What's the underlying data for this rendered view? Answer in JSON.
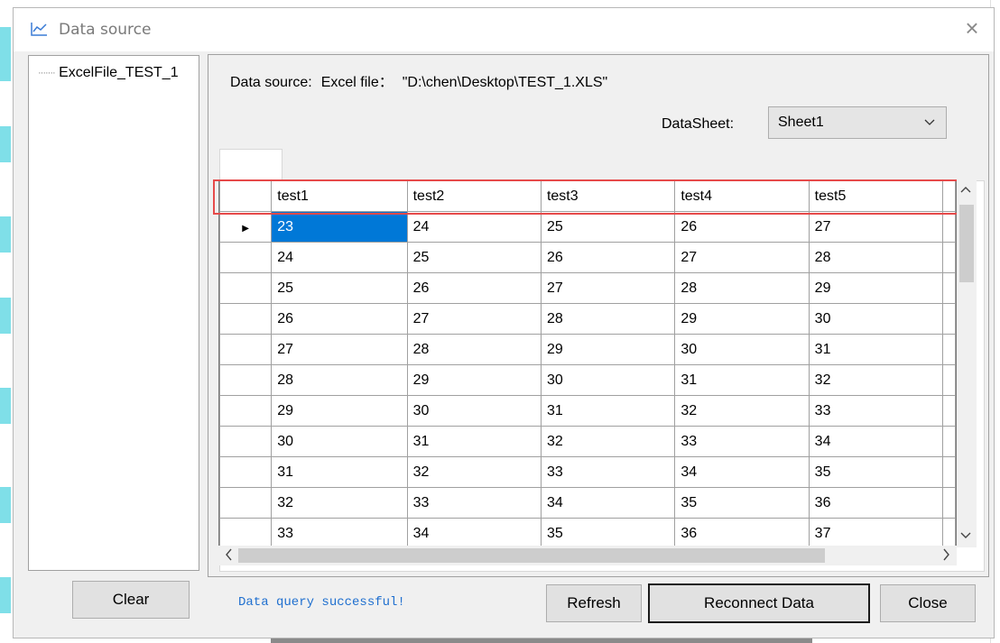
{
  "window": {
    "title": "Data source",
    "title_icon": "line-chart-icon",
    "close_icon": "close-icon",
    "close_glyph": "×"
  },
  "tree": {
    "items": [
      {
        "label": "ExcelFile_TEST_1"
      }
    ]
  },
  "buttons": {
    "clear": "Clear",
    "refresh": "Refresh",
    "reconnect": "Reconnect Data",
    "close": "Close"
  },
  "source": {
    "label": "Data source:",
    "type": "Excel file：",
    "path": "\"D:\\chen\\Desktop\\TEST_1.XLS\""
  },
  "datasheet": {
    "label": "DataSheet:",
    "selected": "Sheet1"
  },
  "grid": {
    "columns": [
      "test1",
      "test2",
      "test3",
      "test4",
      "test5"
    ],
    "rows": [
      [
        "23",
        "24",
        "25",
        "26",
        "27"
      ],
      [
        "24",
        "25",
        "26",
        "27",
        "28"
      ],
      [
        "25",
        "26",
        "27",
        "28",
        "29"
      ],
      [
        "26",
        "27",
        "28",
        "29",
        "30"
      ],
      [
        "27",
        "28",
        "29",
        "30",
        "31"
      ],
      [
        "28",
        "29",
        "30",
        "31",
        "32"
      ],
      [
        "29",
        "30",
        "31",
        "32",
        "33"
      ],
      [
        "30",
        "31",
        "32",
        "33",
        "34"
      ],
      [
        "31",
        "32",
        "33",
        "34",
        "35"
      ],
      [
        "32",
        "33",
        "34",
        "35",
        "36"
      ],
      [
        "33",
        "34",
        "35",
        "36",
        "37"
      ]
    ],
    "selected_cell": [
      0,
      0
    ],
    "current_row_glyph": "▶"
  },
  "status": {
    "message": "Data query successful!",
    "color": "#1f6fcf"
  },
  "colors": {
    "selection": "#0078d7",
    "highlight_box": "#e64a4a"
  }
}
